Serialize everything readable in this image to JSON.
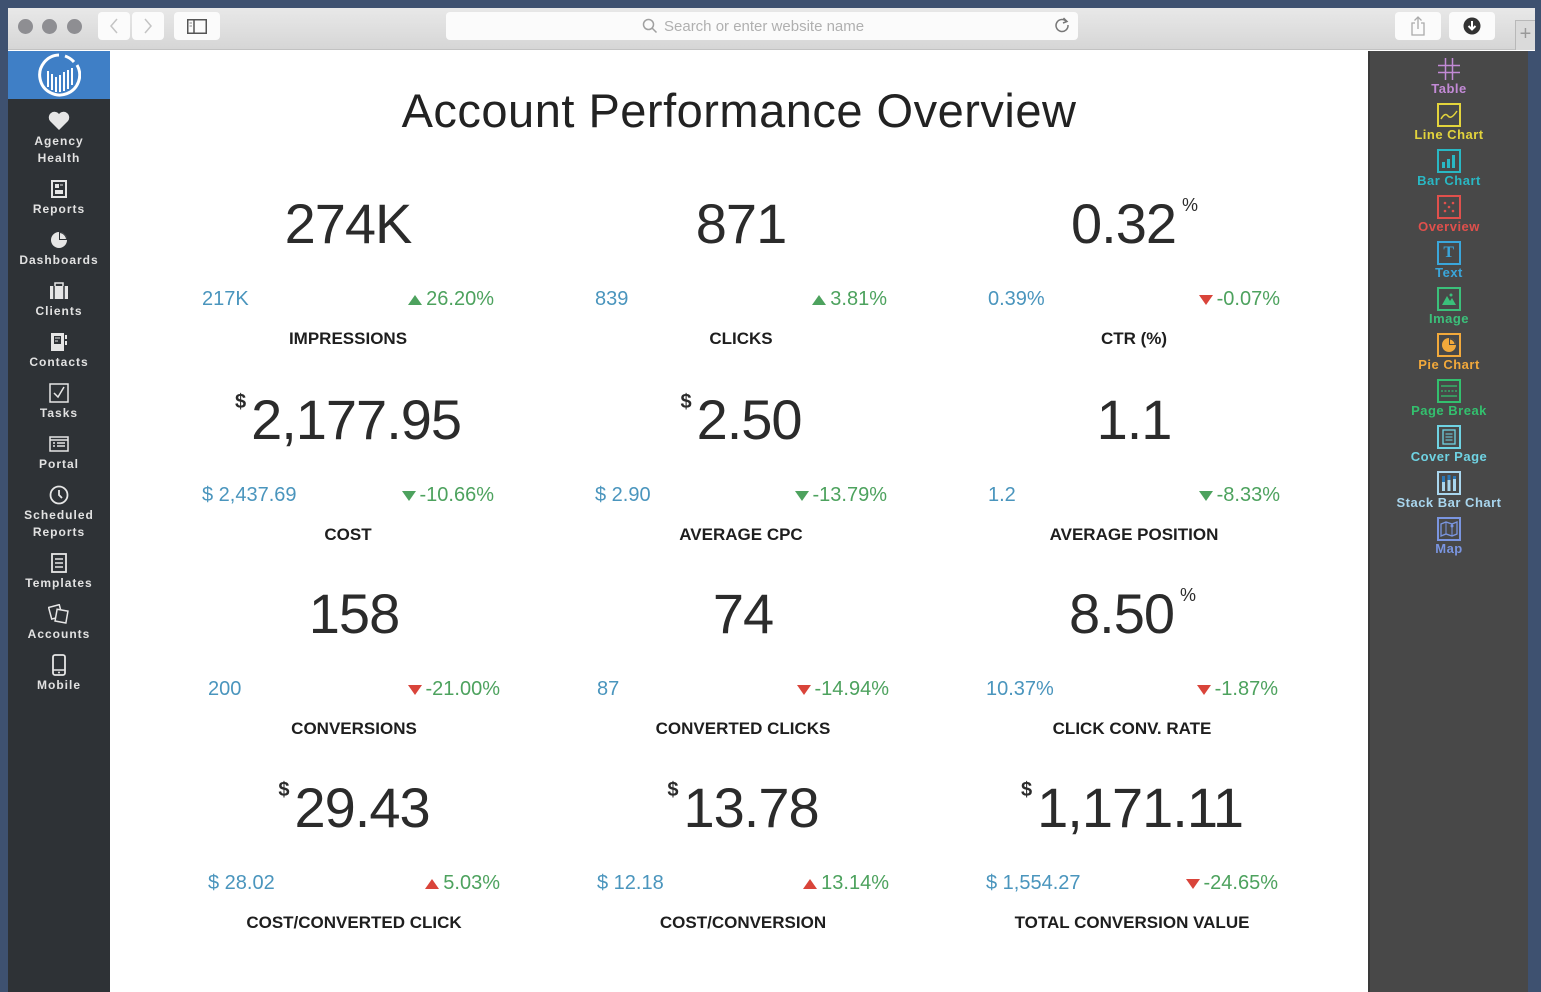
{
  "browser": {
    "url_placeholder": "Search or enter website name",
    "new_tab_label": "+"
  },
  "sidebar": {
    "items": [
      {
        "label": "Agency\nHealth",
        "icon": "heart-icon"
      },
      {
        "label": "Reports",
        "icon": "report-icon"
      },
      {
        "label": "Dashboards",
        "icon": "pie-icon"
      },
      {
        "label": "Clients",
        "icon": "briefcase-icon"
      },
      {
        "label": "Contacts",
        "icon": "address-book-icon"
      },
      {
        "label": "Tasks",
        "icon": "checkbox-icon"
      },
      {
        "label": "Portal",
        "icon": "portal-icon"
      },
      {
        "label": "Scheduled\nReports",
        "icon": "clock-icon"
      },
      {
        "label": "Templates",
        "icon": "template-icon"
      },
      {
        "label": "Accounts",
        "icon": "accounts-icon"
      },
      {
        "label": "Mobile",
        "icon": "mobile-icon"
      }
    ]
  },
  "main": {
    "title": "Account Performance Overview",
    "metrics": [
      {
        "value": "274K",
        "prefix": "",
        "suffix": "",
        "previous": "217K",
        "change": "26.20%",
        "direction": "up",
        "arrow_color": "#4da25e",
        "label": "IMPRESSIONS"
      },
      {
        "value": "871",
        "prefix": "",
        "suffix": "",
        "previous": "839",
        "change": "3.81%",
        "direction": "up",
        "arrow_color": "#4da25e",
        "label": "CLICKS"
      },
      {
        "value": "0.32",
        "prefix": "",
        "suffix": "%",
        "previous": "0.39%",
        "change": "-0.07%",
        "direction": "down",
        "arrow_color": "#d9443a",
        "label": "CTR (%)"
      },
      {
        "value": "2,177.95",
        "prefix": "$",
        "suffix": "",
        "previous": "$ 2,437.69",
        "change": "-10.66%",
        "direction": "down",
        "arrow_color": "#4da25e",
        "label": "COST"
      },
      {
        "value": "2.50",
        "prefix": "$",
        "suffix": "",
        "previous": "$ 2.90",
        "change": "-13.79%",
        "direction": "down",
        "arrow_color": "#4da25e",
        "label": "AVERAGE CPC"
      },
      {
        "value": "1.1",
        "prefix": "",
        "suffix": "",
        "previous": "1.2",
        "change": "-8.33%",
        "direction": "down",
        "arrow_color": "#4da25e",
        "label": "AVERAGE POSITION"
      },
      {
        "value": "158",
        "prefix": "",
        "suffix": "",
        "previous": "200",
        "change": "-21.00%",
        "direction": "down",
        "arrow_color": "#d9443a",
        "label": "CONVERSIONS"
      },
      {
        "value": "74",
        "prefix": "",
        "suffix": "",
        "previous": "87",
        "change": "-14.94%",
        "direction": "down",
        "arrow_color": "#d9443a",
        "label": "CONVERTED CLICKS"
      },
      {
        "value": "8.50",
        "prefix": "",
        "suffix": "%",
        "previous": "10.37%",
        "change": "-1.87%",
        "direction": "down",
        "arrow_color": "#d9443a",
        "label": "CLICK CONV. RATE"
      },
      {
        "value": "29.43",
        "prefix": "$",
        "suffix": "",
        "previous": "$ 28.02",
        "change": "5.03%",
        "direction": "up",
        "arrow_color": "#d9443a",
        "label": "COST/CONVERTED CLICK"
      },
      {
        "value": "13.78",
        "prefix": "$",
        "suffix": "",
        "previous": "$ 12.18",
        "change": "13.14%",
        "direction": "up",
        "arrow_color": "#d9443a",
        "label": "COST/CONVERSION"
      },
      {
        "value": "1,171.11",
        "prefix": "$",
        "suffix": "",
        "previous": "$ 1,554.27",
        "change": "-24.65%",
        "direction": "down",
        "arrow_color": "#d9443a",
        "label": "TOTAL CONVERSION VALUE"
      }
    ]
  },
  "widgets": {
    "items": [
      {
        "label": "Table",
        "icon": "table-icon",
        "color": "#c38ad6"
      },
      {
        "label": "Line Chart",
        "icon": "line-chart-icon",
        "color": "#e3d43c"
      },
      {
        "label": "Bar Chart",
        "icon": "bar-chart-icon",
        "color": "#29b8c4"
      },
      {
        "label": "Overview",
        "icon": "overview-icon",
        "color": "#e0504c"
      },
      {
        "label": "Text",
        "icon": "text-icon",
        "color": "#3aa6db"
      },
      {
        "label": "Image",
        "icon": "image-icon",
        "color": "#3bc07a"
      },
      {
        "label": "Pie Chart",
        "icon": "pie-chart-icon",
        "color": "#f2a93b"
      },
      {
        "label": "Page Break",
        "icon": "page-break-icon",
        "color": "#33c06e"
      },
      {
        "label": "Cover Page",
        "icon": "cover-page-icon",
        "color": "#6fd3e3"
      },
      {
        "label": "Stack Bar Chart",
        "icon": "stack-bar-chart-icon",
        "color": "#a9d6ee"
      },
      {
        "label": "Map",
        "icon": "map-icon",
        "color": "#7a95e0"
      }
    ]
  },
  "colors": {
    "previous_value": "#4a95bd",
    "change_text": "#4da25e",
    "sidebar_logo_bg": "#3f7fc6"
  }
}
